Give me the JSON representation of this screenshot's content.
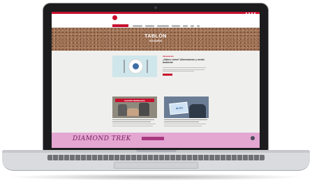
{
  "page": {
    "hero_title": "TABLÓN",
    "hero_subtitle": "SOLIDARIO"
  },
  "featured": {
    "category": "Alimentación",
    "title": "¿Sabes cómo? Alimentación y medio ambiente"
  },
  "cards": [
    {
      "banner": "EQUIPO REINICIATE"
    },
    {
      "sign": "BLOG"
    }
  ],
  "promo": {
    "title": "DIAMOND TREK"
  },
  "icons": {
    "social": [
      "facebook-icon",
      "twitter-icon",
      "instagram-icon",
      "youtube-icon"
    ],
    "logo": "logo-icon"
  },
  "colors": {
    "brand_red": "#c8102e",
    "promo_pink": "#e4a7d2",
    "promo_text": "#7a2064"
  }
}
